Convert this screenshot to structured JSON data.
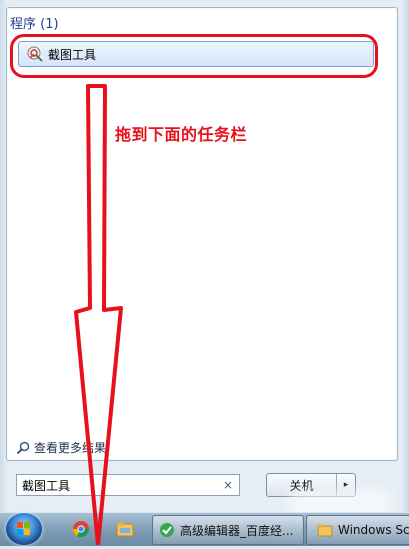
{
  "start_menu": {
    "section_title": "程序 (1)",
    "program_item": {
      "label": "截图工具",
      "icon": "snipping-tool-icon"
    },
    "search_more_label": "查看更多结果",
    "search": {
      "value": "截图工具",
      "clear_label": "×"
    },
    "shutdown": {
      "label": "关机",
      "arrow_label": "▸"
    }
  },
  "annotation": {
    "text": "拖到下面的任务栏",
    "color": "#e8101c"
  },
  "taskbar": {
    "tasks": [
      {
        "label": "高级编辑器_百度经...",
        "icon": "browser-green-icon"
      },
      {
        "label": "Windows Sc",
        "icon": "folder-icon"
      }
    ],
    "pinned": [
      {
        "icon": "chrome-icon"
      },
      {
        "icon": "explorer-icon"
      }
    ]
  }
}
